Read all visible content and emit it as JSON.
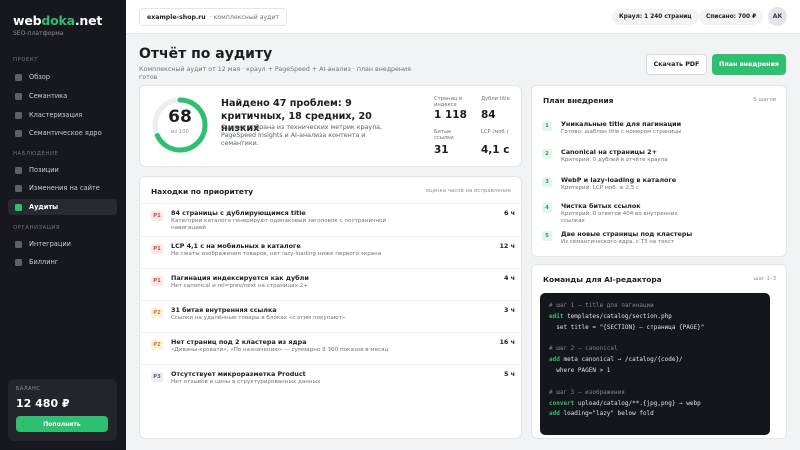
{
  "brand": {
    "name_prefix": "web",
    "name_accent": "doka",
    "name_suffix": ".net",
    "subtitle": "SEO-платформа"
  },
  "sidebar": {
    "sections": [
      {
        "label": "ПРОЕКТ",
        "items": [
          {
            "label": "Обзор"
          },
          {
            "label": "Семантика"
          },
          {
            "label": "Кластеризация"
          },
          {
            "label": "Семантическое ядро"
          }
        ]
      },
      {
        "label": "НАБЛЮДЕНИЕ",
        "items": [
          {
            "label": "Позиции"
          },
          {
            "label": "Изменения на сайте"
          },
          {
            "label": "Аудиты",
            "active": true
          }
        ]
      },
      {
        "label": "ОРГАНИЗАЦИЯ",
        "items": [
          {
            "label": "Интеграции"
          },
          {
            "label": "Биллинг"
          }
        ]
      }
    ],
    "balance": {
      "label": "БАЛАНС",
      "value": "12 480 ₽",
      "button": "Пополнить"
    }
  },
  "topbar": {
    "site": "example-shop.ru",
    "site_desc": "· комплексный аудит",
    "crawl": "Краул: 1 240 страниц",
    "charged": "Списано: 700 ₽",
    "avatar": "АК"
  },
  "header": {
    "title": "Отчёт по аудиту",
    "subtitle": "Комплексный аудит от 12 мая · краул + PageSpeed + AI-анализ · план внедрения готов",
    "download_button": "Скачать PDF",
    "plan_button": "План внедрения"
  },
  "summary": {
    "score": "68",
    "score_of": "из 100",
    "score_fraction": 0.68,
    "title": "Найдено 47 проблем: 9 критичных, 18 средних, 20 низких",
    "description": "Оценка собрана из технических метрик краула, PageSpeed Insights и AI-анализа контента и семантики.",
    "stats": [
      {
        "label": "Страниц в индексе",
        "value": "1 118"
      },
      {
        "label": "Дубли title",
        "value": "84"
      },
      {
        "label": "Битые ссылки",
        "value": "31"
      },
      {
        "label": "LCP (моб.)",
        "value": "4,1 с"
      }
    ]
  },
  "findings": {
    "title": "Находки по приоритету",
    "meta": "оценка часов на исправление",
    "items": [
      {
        "priority": "P1",
        "title": "84 страницы с дублирующимся title",
        "desc": "Категории каталога генерируют одинаковый заголовок с постраничной навигацией",
        "hours": "6 ч"
      },
      {
        "priority": "P1",
        "title": "LCP 4,1 с на мобильных в каталоге",
        "desc": "Не сжаты изображения товаров, нет lazy-loading ниже первого экрана",
        "hours": "12 ч"
      },
      {
        "priority": "P1",
        "title": "Пагинация индексируется как дубли",
        "desc": "Нет canonical и rel=prev/next на страницах 2+",
        "hours": "4 ч"
      },
      {
        "priority": "P2",
        "title": "31 битая внутренняя ссылка",
        "desc": "Ссылки на удалённые товары в блоках «с этим покупают»",
        "hours": "3 ч"
      },
      {
        "priority": "P2",
        "title": "Нет страниц под 2 кластера из ядра",
        "desc": "«Диваны-кровати», «По назначению» — суммарно 9 360 показов в месяц",
        "hours": "16 ч"
      },
      {
        "priority": "P3",
        "title": "Отсутствует микроразметка Product",
        "desc": "Нет отзывов и цены в структурированных данных",
        "hours": "5 ч"
      }
    ]
  },
  "plan": {
    "title": "План внедрения",
    "meta": "5 шагов",
    "steps": [
      {
        "num": "1",
        "title": "Уникальные title для пагинации",
        "desc": "Готово: шаблон title с номером страницы"
      },
      {
        "num": "2",
        "title": "Canonical на страницы 2+",
        "desc": "Критерий: 0 дублей в отчёте краула"
      },
      {
        "num": "3",
        "title": "WebP и lazy-loading в каталоге",
        "desc": "Критерий: LCP моб. ≤ 2,5 с"
      },
      {
        "num": "4",
        "title": "Чистка битых ссылок",
        "desc": "Критерий: 0 ответов 404 во внутренних ссылках"
      },
      {
        "num": "5",
        "title": "Две новые страницы под кластеры",
        "desc": "Из семантического ядра, с ТЗ на текст"
      }
    ]
  },
  "editor": {
    "title": "Команды для AI-редактора",
    "meta": "шаг 1–3",
    "lines": [
      {
        "type": "comment",
        "text": "# шаг 1 — title для пагинации"
      },
      {
        "type": "kw",
        "kw": "edit",
        "text": " templates/catalog/section.php"
      },
      {
        "type": "plain",
        "text": "  set title = \"{SECTION} — страница {PAGE}\""
      },
      {
        "type": "blank",
        "text": ""
      },
      {
        "type": "comment",
        "text": "# шаг 2 — canonical"
      },
      {
        "type": "kw",
        "kw": "add",
        "text": " meta canonical → /catalog/{code}/"
      },
      {
        "type": "plain",
        "text": "  where PAGEN > 1"
      },
      {
        "type": "blank",
        "text": ""
      },
      {
        "type": "comment",
        "text": "# шаг 3 — изображения"
      },
      {
        "type": "kw",
        "kw": "convert",
        "text": " upload/catalog/**.{jpg,png} → webp"
      },
      {
        "type": "kw",
        "kw": "add",
        "text": " loading=\"lazy\" below fold"
      }
    ]
  },
  "colors": {
    "accent": "#2fbf71",
    "sidebar_bg": "#16181d",
    "p1": "#d94141",
    "p2": "#c98516"
  }
}
